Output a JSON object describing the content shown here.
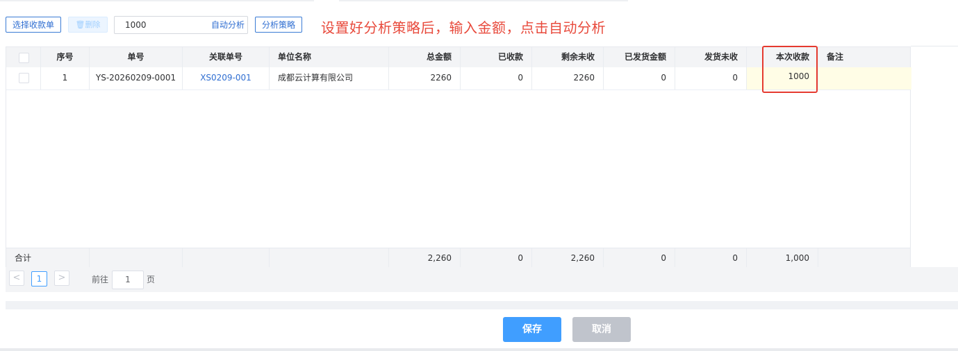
{
  "toolbar": {
    "select_receipt_label": "选择收款单",
    "delete_label": "🗑删除",
    "amount_value": "1000",
    "auto_analyze_label": "自动分析",
    "strategy_label": "分析策略",
    "hint_text": "设置好分析策略后，输入金额，点击自动分析"
  },
  "table": {
    "headers": {
      "seq": "序号",
      "order_no": "单号",
      "related_no": "关联单号",
      "company": "单位名称",
      "total": "总金额",
      "received": "已收款",
      "remaining": "剩余未收",
      "shipped_amount": "已发货金额",
      "shipped_unreceived": "发货未收",
      "this_receipt": "本次收款",
      "remark": "备注"
    },
    "rows": [
      {
        "seq": "1",
        "order_no": "YS-20260209-0001",
        "related_no": "XS0209-001",
        "company": "成都云计算有限公司",
        "total": "2260",
        "received": "0",
        "remaining": "2260",
        "shipped_amount": "0",
        "shipped_unreceived": "0",
        "this_receipt": "1000",
        "remark": ""
      }
    ],
    "summary": {
      "label": "合计",
      "total": "2,260",
      "received": "0",
      "remaining": "2,260",
      "shipped_amount": "0",
      "shipped_unreceived": "0",
      "this_receipt": "1,000"
    }
  },
  "pagination": {
    "prev": "<",
    "current_page": "1",
    "next": ">",
    "goto_label": "前往",
    "goto_value": "1",
    "page_suffix": "页"
  },
  "footer": {
    "save_label": "保存",
    "cancel_label": "取消"
  },
  "colors": {
    "primary": "#409eff",
    "link": "#2f6ed1",
    "hint_red": "#e84a3c",
    "highlight_border": "#e53a2f",
    "editable_bg": "#fffde6"
  }
}
